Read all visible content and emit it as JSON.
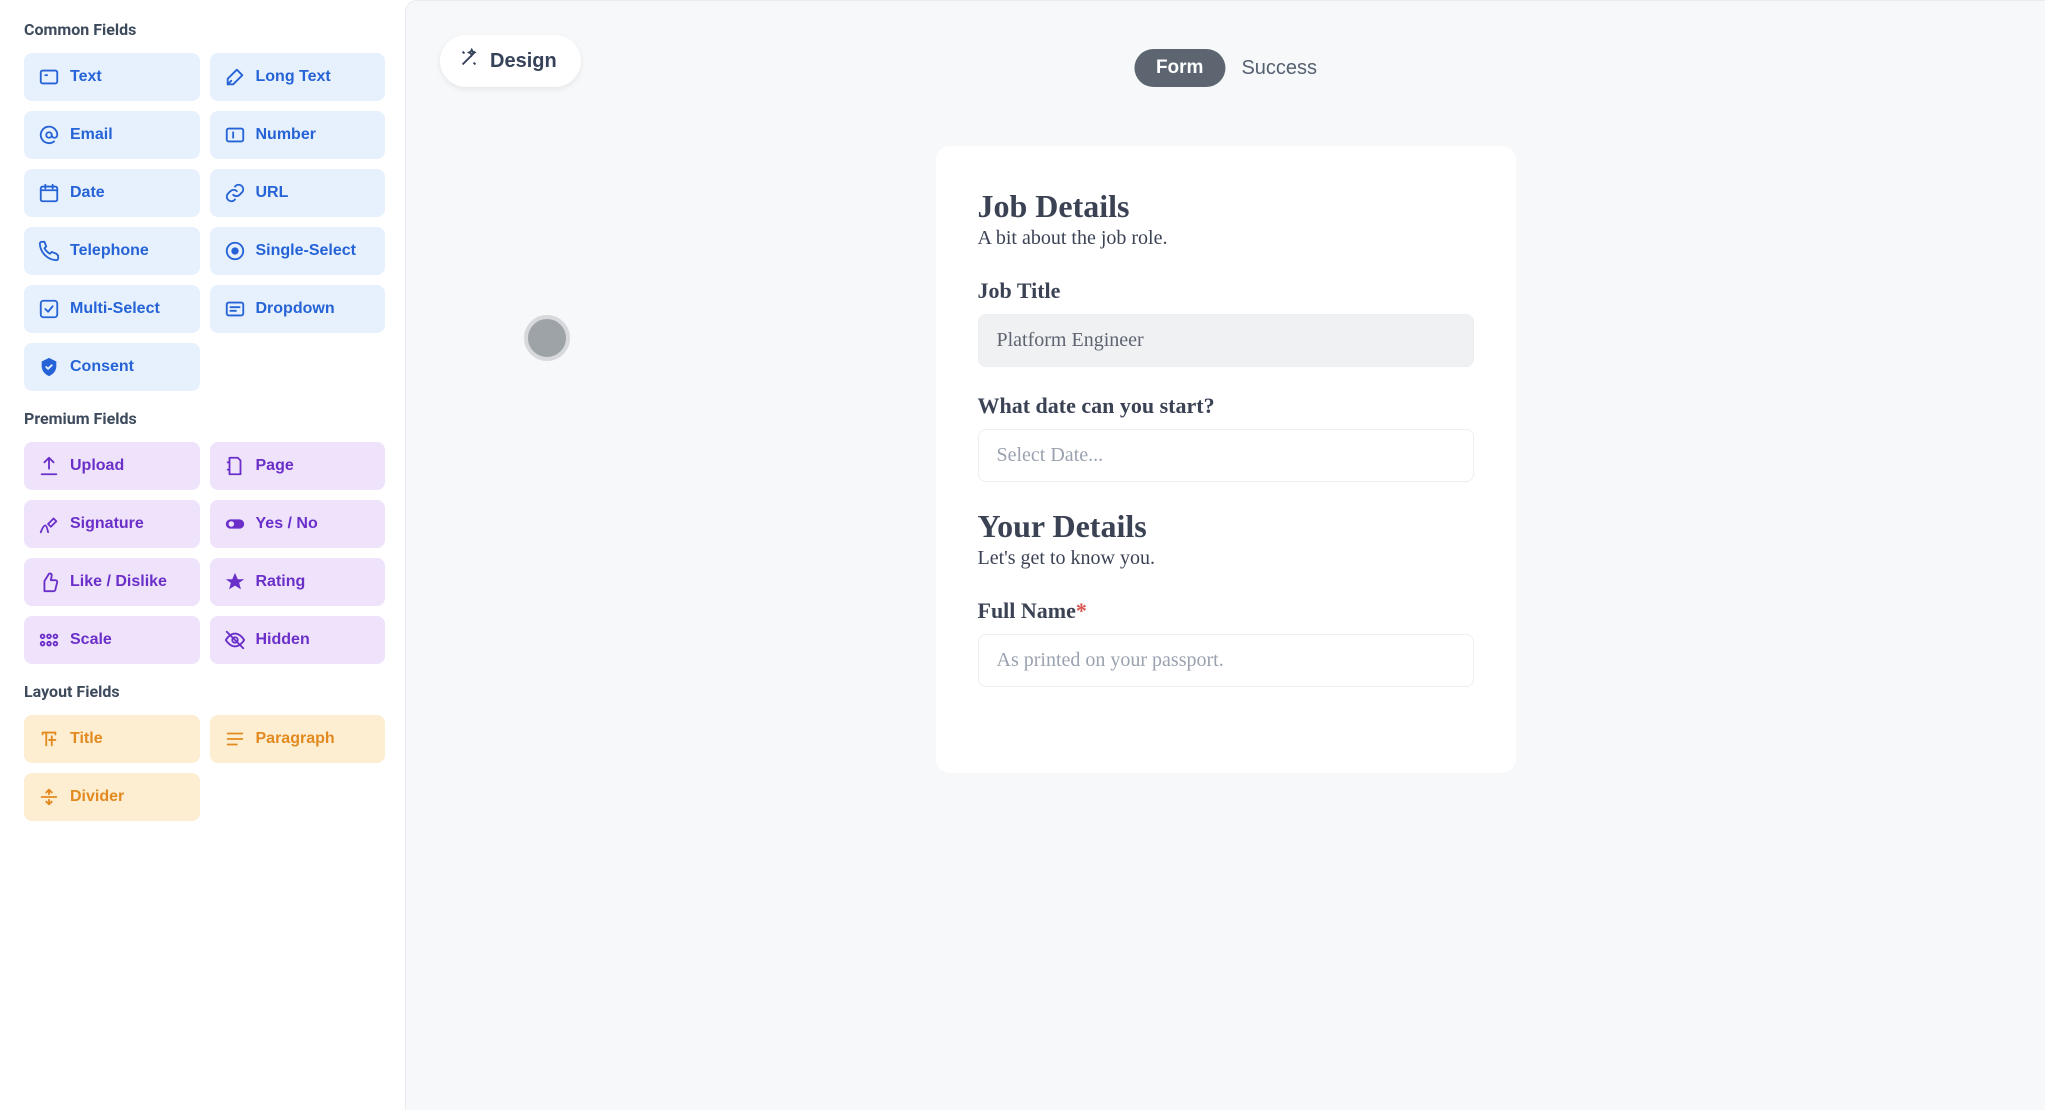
{
  "sidebar": {
    "sections": {
      "common": {
        "title": "Common Fields",
        "items": [
          "Text",
          "Long Text",
          "Email",
          "Number",
          "Date",
          "URL",
          "Telephone",
          "Single-Select",
          "Multi-Select",
          "Dropdown",
          "Consent"
        ]
      },
      "premium": {
        "title": "Premium Fields",
        "items": [
          "Upload",
          "Page",
          "Signature",
          "Yes / No",
          "Like / Dislike",
          "Rating",
          "Scale",
          "Hidden"
        ]
      },
      "layout": {
        "title": "Layout Fields",
        "items": [
          "Title",
          "Paragraph",
          "Divider"
        ]
      }
    }
  },
  "header": {
    "design_label": "Design",
    "tabs": {
      "form": "Form",
      "success": "Success"
    }
  },
  "form": {
    "sections": [
      {
        "title": "Job Details",
        "subtitle": "A bit about the job role.",
        "fields": [
          {
            "label": "Job Title",
            "value": "Platform Engineer",
            "type": "text",
            "disabled": true
          },
          {
            "label": "What date can you start?",
            "placeholder": "Select Date...",
            "type": "date"
          }
        ]
      },
      {
        "title": "Your Details",
        "subtitle": "Let's get to know you.",
        "fields": [
          {
            "label": "Full Name",
            "required": true,
            "placeholder": "As printed on your passport.",
            "type": "text"
          }
        ]
      }
    ]
  }
}
